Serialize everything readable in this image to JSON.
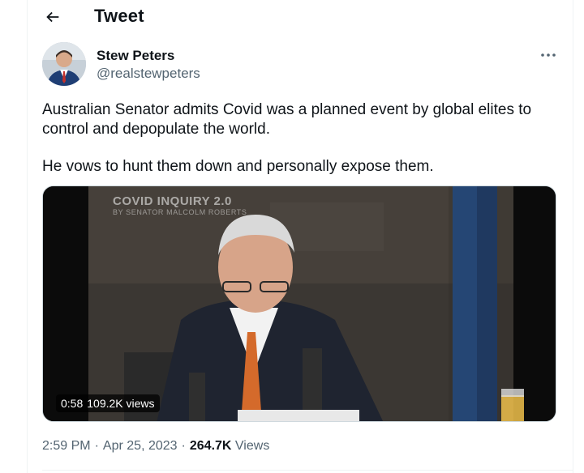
{
  "topbar": {
    "title": "Tweet",
    "back_icon": "arrow-left-icon"
  },
  "author": {
    "name": "Stew Peters",
    "handle": "@realstewpeters",
    "more_icon": "more-dots-icon"
  },
  "tweet": {
    "paragraphs": [
      "Australian Senator admits Covid was a planned event by global elites to control and depopulate the world.",
      "He vows to hunt them down and personally expose them."
    ]
  },
  "media": {
    "overlay_title": "COVID INQUIRY 2.0",
    "overlay_subtitle": "BY SENATOR MALCOLM ROBERTS",
    "duration": "0:58",
    "views": "109.2K views"
  },
  "meta": {
    "time": "2:59 PM",
    "date": "Apr 25, 2023",
    "view_count": "264.7K",
    "views_label": "Views"
  },
  "colors": {
    "text_primary": "#0f1419",
    "text_secondary": "#536471",
    "border": "#eff3f4"
  }
}
